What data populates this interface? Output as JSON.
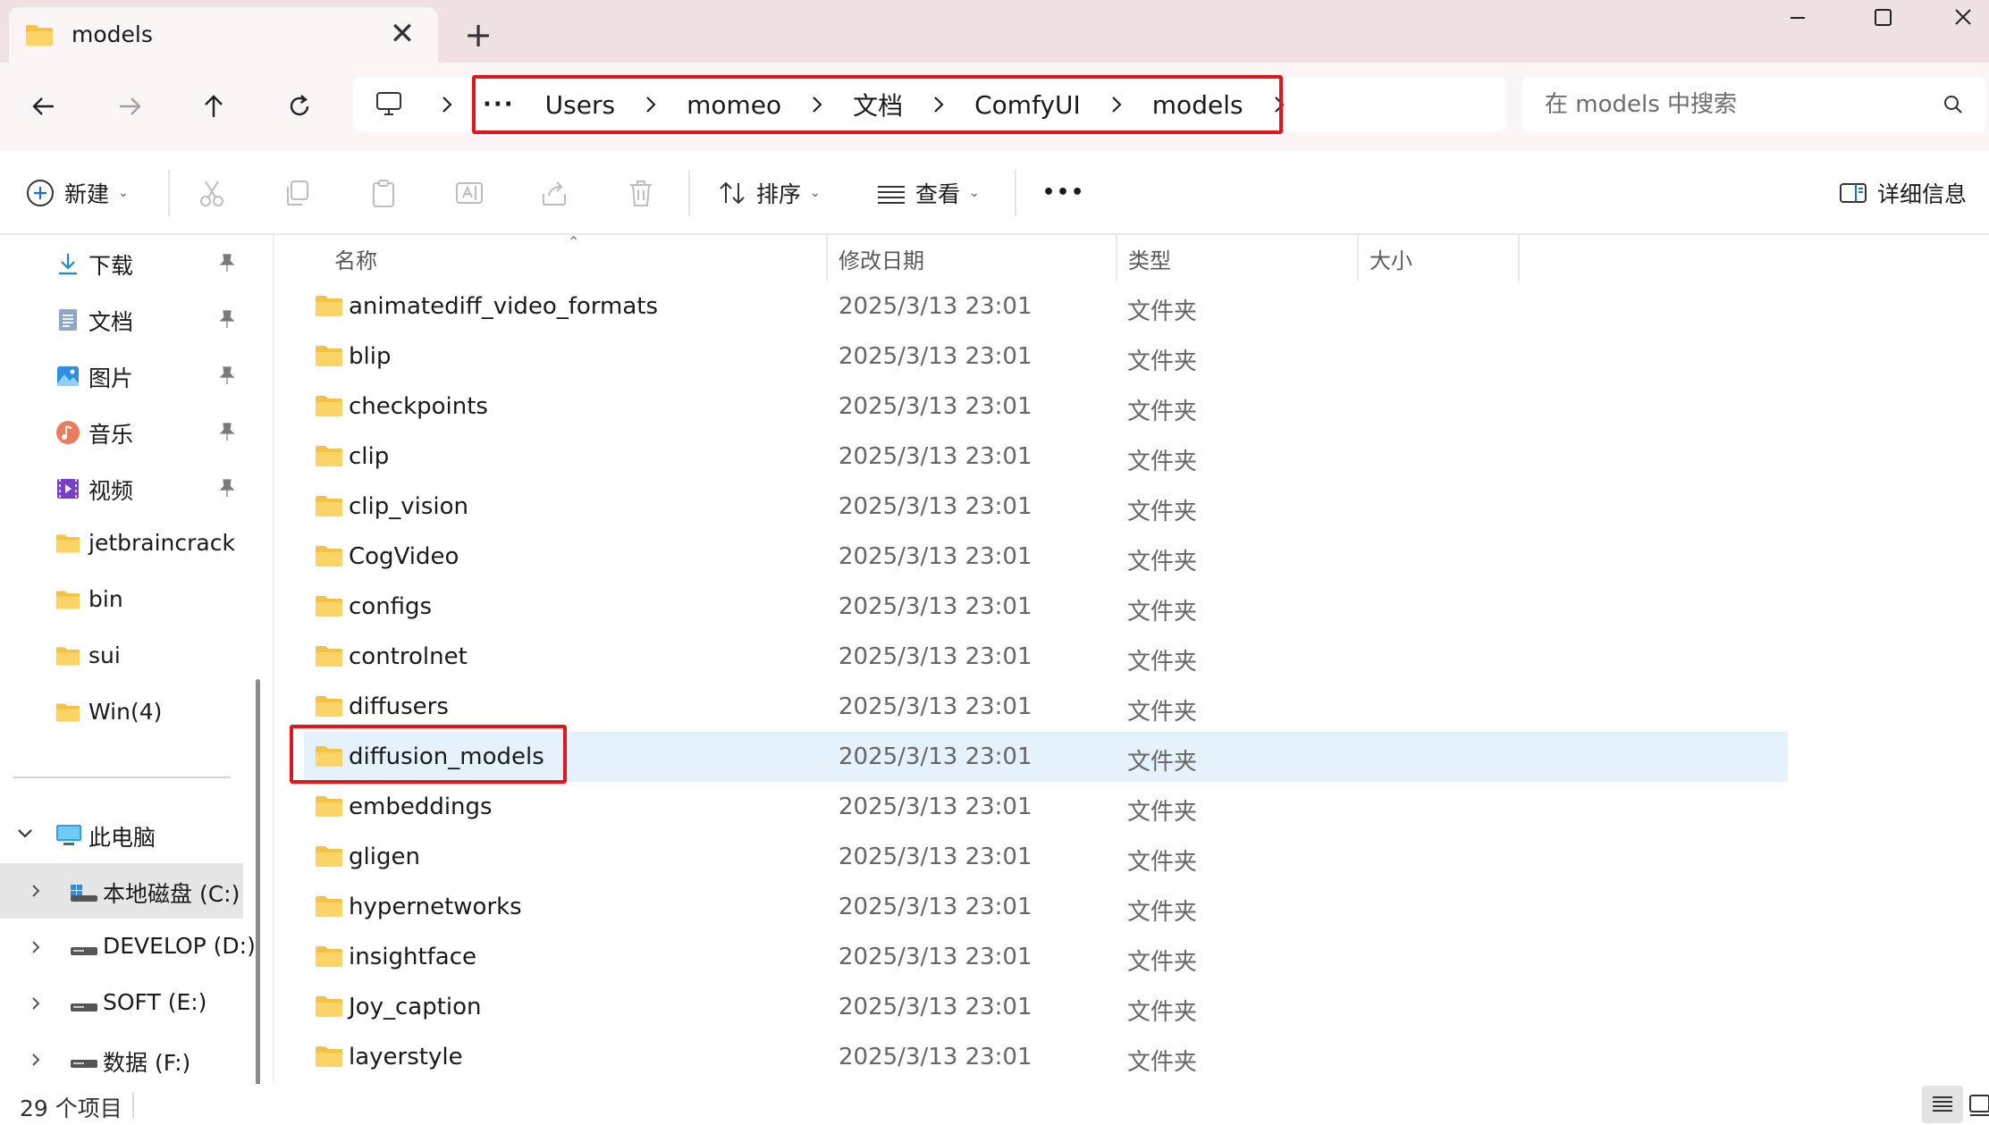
{
  "tab": {
    "title": "models",
    "close_glyph": "✕",
    "add_glyph": "+"
  },
  "address": {
    "more": "···",
    "crumbs": [
      "Users",
      "momeo",
      "文档",
      "ComfyUI",
      "models"
    ]
  },
  "search": {
    "placeholder": "在 models 中搜索",
    "value": ""
  },
  "toolbar": {
    "new_label": "新建",
    "sort_label": "排序",
    "view_label": "查看",
    "more_glyph": "•••",
    "details_label": "详细信息"
  },
  "sidebar": {
    "quick": [
      {
        "label": "下载",
        "icon": "download-icon"
      },
      {
        "label": "文档",
        "icon": "document-icon"
      },
      {
        "label": "图片",
        "icon": "pictures-icon"
      },
      {
        "label": "音乐",
        "icon": "music-icon"
      },
      {
        "label": "视频",
        "icon": "video-icon"
      }
    ],
    "folders": [
      "jetbraincrack",
      "bin",
      "sui",
      "Win(4)"
    ],
    "this_pc": "此电脑",
    "drives": [
      "本地磁盘 (C:)",
      "DEVELOP (D:)",
      "SOFT (E:)",
      "数据 (F:)"
    ]
  },
  "columns": {
    "name": "名称",
    "date": "修改日期",
    "type": "类型",
    "size": "大小"
  },
  "files": [
    {
      "name": "animatediff_video_formats",
      "date": "2025/3/13 23:01",
      "type": "文件夹"
    },
    {
      "name": "blip",
      "date": "2025/3/13 23:01",
      "type": "文件夹"
    },
    {
      "name": "checkpoints",
      "date": "2025/3/13 23:01",
      "type": "文件夹"
    },
    {
      "name": "clip",
      "date": "2025/3/13 23:01",
      "type": "文件夹"
    },
    {
      "name": "clip_vision",
      "date": "2025/3/13 23:01",
      "type": "文件夹"
    },
    {
      "name": "CogVideo",
      "date": "2025/3/13 23:01",
      "type": "文件夹"
    },
    {
      "name": "configs",
      "date": "2025/3/13 23:01",
      "type": "文件夹"
    },
    {
      "name": "controlnet",
      "date": "2025/3/13 23:01",
      "type": "文件夹"
    },
    {
      "name": "diffusers",
      "date": "2025/3/13 23:01",
      "type": "文件夹"
    },
    {
      "name": "diffusion_models",
      "date": "2025/3/13 23:01",
      "type": "文件夹"
    },
    {
      "name": "embeddings",
      "date": "2025/3/13 23:01",
      "type": "文件夹"
    },
    {
      "name": "gligen",
      "date": "2025/3/13 23:01",
      "type": "文件夹"
    },
    {
      "name": "hypernetworks",
      "date": "2025/3/13 23:01",
      "type": "文件夹"
    },
    {
      "name": "insightface",
      "date": "2025/3/13 23:01",
      "type": "文件夹"
    },
    {
      "name": "Joy_caption",
      "date": "2025/3/13 23:01",
      "type": "文件夹"
    },
    {
      "name": "layerstyle",
      "date": "2025/3/13 23:01",
      "type": "文件夹"
    }
  ],
  "status": {
    "item_count": "29 个项目"
  },
  "colors": {
    "highlight": "#e3141b",
    "folder": "#f5c242",
    "hover_row": "#e5f1fb",
    "titlebar": "#f0e2e3"
  }
}
